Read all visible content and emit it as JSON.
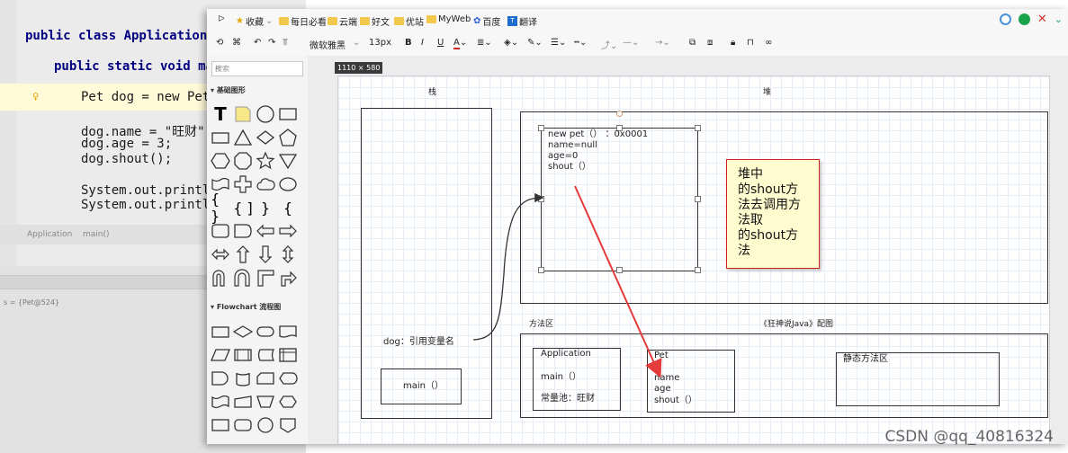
{
  "editor": {
    "line1": "public class Application {",
    "line2": "public static void mai",
    "line3": "Pet dog = new Pet(",
    "line4": "dog.name = \"旺财\";",
    "line5": "dog.age = 3;",
    "line6": "dog.shout();",
    "line7": "System.out.println",
    "line8": "System.out.println",
    "breadcrumb_1": "Application",
    "breadcrumb_2": "main()",
    "debug_var": "s = {Pet@524}"
  },
  "bookmarks": {
    "b1": "收藏",
    "b2": "每日必看",
    "b3": "云端",
    "b4": "好文",
    "b5": "优站",
    "b6": "MyWeb",
    "b7": "百度",
    "b8": "翻译"
  },
  "toolbar": {
    "font": "微软雅黑",
    "size": "13px"
  },
  "sidebar": {
    "search_placeholder": "搜索",
    "section1": "基础图形",
    "section2": "Flowchart 流程图"
  },
  "canvas": {
    "size_label": "1110 × 580",
    "stack_title": "栈",
    "heap_title": "堆",
    "method_area_title": "方法区",
    "caption": "《狂神说Java》配图",
    "object_text": [
      "new pet（） ：0x0001",
      "name=null",
      "age=0",
      "shout（）"
    ],
    "dog_ref": "dog：引用变量名",
    "main_label": "main（）",
    "application_box": [
      "Application",
      "main（）",
      "常量池：旺财"
    ],
    "pet_box": [
      "Pet",
      "name",
      "age",
      "shout（）"
    ],
    "static_area": "静态方法区",
    "note": "堆中\n的shout方\n法去调用方\n法取\n的shout方\n法"
  },
  "watermark": "CSDN @qq_40816324"
}
